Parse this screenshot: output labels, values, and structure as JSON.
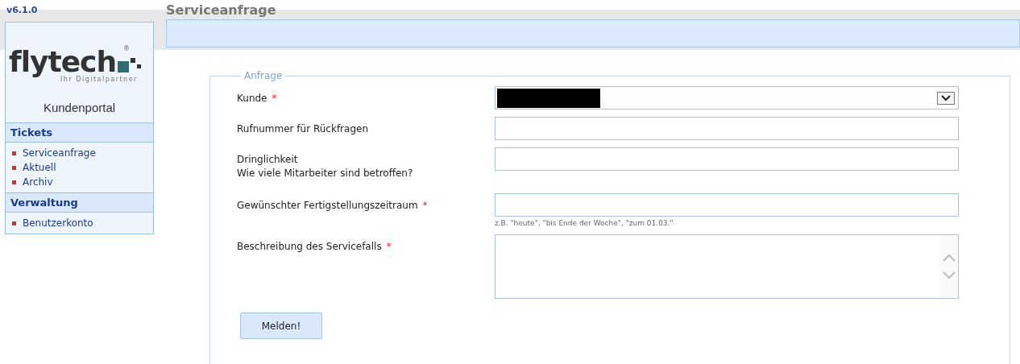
{
  "version": "v6.1.0",
  "page_title": "Serviceanfrage",
  "sidebar": {
    "logo": {
      "wordmark": "flytech",
      "registered": "®",
      "tagline": "Ihr Digitalpartner"
    },
    "portal_name": "Kundenportal",
    "sections": [
      {
        "title": "Tickets",
        "items": [
          "Serviceanfrage",
          "Aktuell",
          "Archiv"
        ]
      },
      {
        "title": "Verwaltung",
        "items": [
          "Benutzerkonto"
        ]
      }
    ]
  },
  "form": {
    "legend": "Anfrage",
    "fields": [
      {
        "kind": "select",
        "label": "Kunde",
        "required_mark": "*",
        "redacted": true
      },
      {
        "kind": "text",
        "label": "Rufnummer für Rückfragen"
      },
      {
        "kind": "text",
        "label": "Dringlichkeit",
        "sublabel": "Wie viele Mitarbeiter sind betroffen?"
      },
      {
        "kind": "text",
        "label": "Gewünschter Fertigstellungszeitraum",
        "required_mark": "*",
        "hint": "z.B. \"heute\", \"bis Ende der Woche\", \"zum 01.03.\""
      },
      {
        "kind": "textarea",
        "label": "Beschreibung des Servicefalls",
        "required_mark": "*"
      }
    ],
    "submit": "Melden!"
  }
}
